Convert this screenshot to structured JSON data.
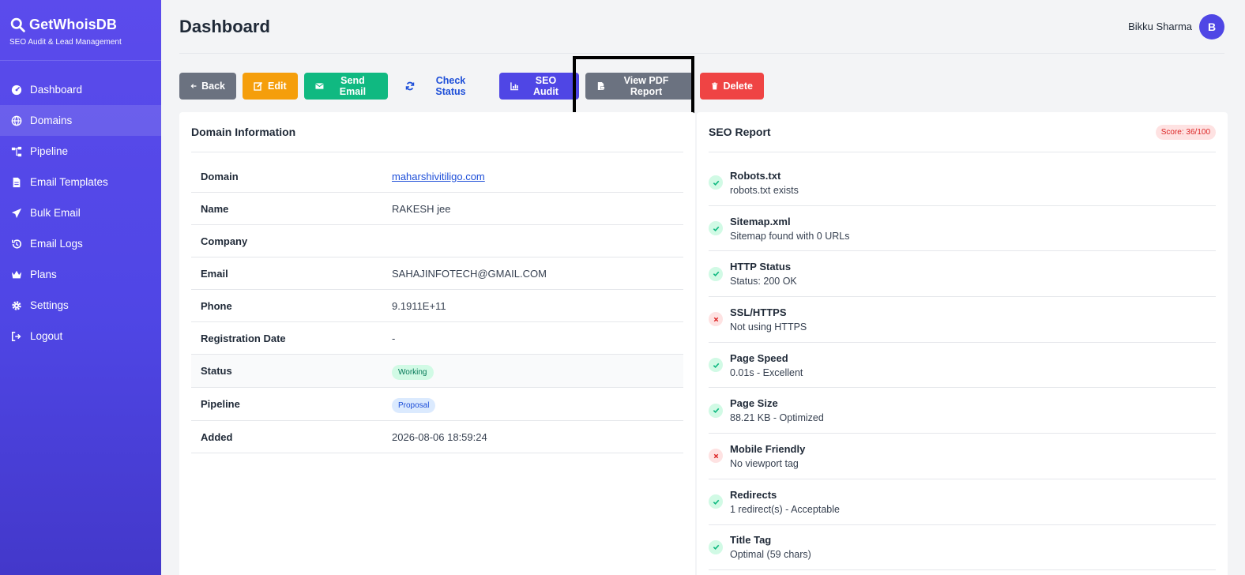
{
  "brand": {
    "title": "GetWhoisDB",
    "subtitle": "SEO Audit & Lead Management"
  },
  "sidebar": {
    "items": [
      {
        "label": "Dashboard",
        "icon": "gauge-icon"
      },
      {
        "label": "Domains",
        "icon": "globe-icon",
        "active": true
      },
      {
        "label": "Pipeline",
        "icon": "sitemap-icon"
      },
      {
        "label": "Email Templates",
        "icon": "file-icon"
      },
      {
        "label": "Bulk Email",
        "icon": "paper-plane-icon"
      },
      {
        "label": "Email Logs",
        "icon": "history-icon"
      },
      {
        "label": "Plans",
        "icon": "crown-icon"
      },
      {
        "label": "Settings",
        "icon": "gear-icon"
      },
      {
        "label": "Logout",
        "icon": "logout-icon"
      }
    ]
  },
  "header": {
    "title": "Dashboard",
    "user_name": "Bikku Sharma",
    "avatar_initial": "B"
  },
  "actions": {
    "back": "Back",
    "edit": "Edit",
    "send_email": "Send Email",
    "check_status": "Check Status",
    "seo_audit": "SEO Audit",
    "view_pdf": "View PDF Report",
    "delete": "Delete"
  },
  "domain_info": {
    "title": "Domain Information",
    "rows": [
      {
        "label": "Domain",
        "value": "maharshivitiligo.com"
      },
      {
        "label": "Name",
        "value": "RAKESH jee"
      },
      {
        "label": "Company",
        "value": ""
      },
      {
        "label": "Email",
        "value": "SAHAJINFOTECH@GMAIL.COM"
      },
      {
        "label": "Phone",
        "value": "9.1911E+11"
      },
      {
        "label": "Registration Date",
        "value": "-"
      },
      {
        "label": "Status",
        "value": "Working"
      },
      {
        "label": "Pipeline",
        "value": "Proposal"
      },
      {
        "label": "Added",
        "value": "2026-08-06 18:59:24"
      }
    ]
  },
  "seo_report": {
    "title": "SEO Report",
    "score": "Score: 36/100",
    "items": [
      {
        "title": "Robots.txt",
        "desc": "robots.txt exists",
        "status": "pass"
      },
      {
        "title": "Sitemap.xml",
        "desc": "Sitemap found with 0 URLs",
        "status": "pass"
      },
      {
        "title": "HTTP Status",
        "desc": "Status: 200 OK",
        "status": "pass"
      },
      {
        "title": "SSL/HTTPS",
        "desc": "Not using HTTPS",
        "status": "fail"
      },
      {
        "title": "Page Speed",
        "desc": "0.01s - Excellent",
        "status": "pass"
      },
      {
        "title": "Page Size",
        "desc": "88.21 KB - Optimized",
        "status": "pass"
      },
      {
        "title": "Mobile Friendly",
        "desc": "No viewport tag",
        "status": "fail"
      },
      {
        "title": "Redirects",
        "desc": "1 redirect(s) - Acceptable",
        "status": "pass"
      },
      {
        "title": "Title Tag",
        "desc": "Optimal (59 chars)",
        "status": "pass"
      }
    ]
  }
}
